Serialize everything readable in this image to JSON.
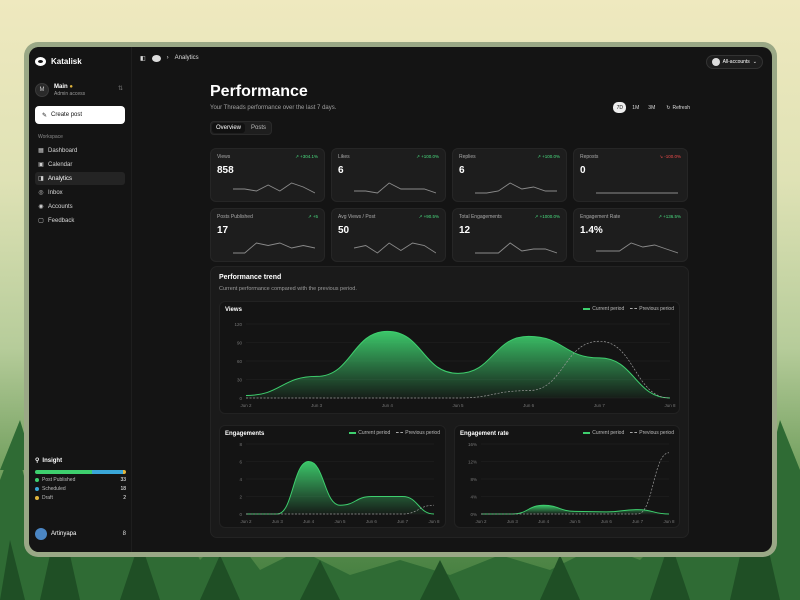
{
  "app": {
    "name": "Katalisk"
  },
  "account": {
    "initial": "M",
    "name": "Main",
    "role": "Admin access"
  },
  "create_post": "Create post",
  "sidebar": {
    "section": "Workspace",
    "items": [
      {
        "label": "Dashboard"
      },
      {
        "label": "Calendar"
      },
      {
        "label": "Analytics"
      },
      {
        "label": "Inbox"
      },
      {
        "label": "Accounts"
      },
      {
        "label": "Feedback"
      }
    ]
  },
  "insight": {
    "title": "Insight",
    "items": [
      {
        "label": "Post Published",
        "value": "33",
        "color": "#3ecf6e"
      },
      {
        "label": "Scheduled",
        "value": "18",
        "color": "#3aa7d8"
      },
      {
        "label": "Draft",
        "value": "2",
        "color": "#e0b43c"
      }
    ]
  },
  "user": {
    "name": "Artinyapa",
    "count": "8"
  },
  "breadcrumb": {
    "page": "Analytics"
  },
  "account_switch": "All-accounts",
  "page": {
    "title": "Performance",
    "subtitle": "Your Threads performance over the last 7 days."
  },
  "ranges": [
    "7D",
    "1M",
    "3M"
  ],
  "refresh": "Refresh",
  "tabs": [
    "Overview",
    "Posts"
  ],
  "metrics": [
    {
      "label": "Views",
      "change": "+304.1%",
      "value": "858",
      "trend": "up",
      "spark": [
        3,
        3,
        2,
        5,
        2,
        6,
        4,
        1
      ]
    },
    {
      "label": "Likes",
      "change": "+100.0%",
      "value": "6",
      "trend": "up",
      "spark": [
        2,
        2,
        1,
        6,
        3,
        3,
        3,
        1
      ]
    },
    {
      "label": "Replies",
      "change": "+100.0%",
      "value": "6",
      "trend": "up",
      "spark": [
        1,
        1,
        2,
        6,
        3,
        4,
        2,
        2
      ]
    },
    {
      "label": "Reposts",
      "change": "-100.0%",
      "value": "0",
      "trend": "down",
      "spark": [
        2,
        2,
        2,
        2,
        2,
        2,
        2,
        2
      ]
    },
    {
      "label": "Posts Published",
      "change": "+5",
      "value": "17",
      "trend": "up",
      "spark": [
        1,
        1,
        5,
        4,
        5,
        3,
        4,
        3
      ]
    },
    {
      "label": "Avg Views / Post",
      "change": "+90.5%",
      "value": "50",
      "trend": "up",
      "spark": [
        3,
        4,
        1,
        5,
        2,
        5,
        4,
        1
      ]
    },
    {
      "label": "Total Engagements",
      "change": "+1000.0%",
      "value": "12",
      "trend": "up",
      "spark": [
        1,
        1,
        1,
        6,
        2,
        3,
        3,
        1
      ]
    },
    {
      "label": "Engagement Rate",
      "change": "+136.5%",
      "value": "1.4%",
      "trend": "up",
      "spark": [
        2,
        2,
        2,
        6,
        4,
        5,
        3,
        1
      ]
    }
  ],
  "trend": {
    "title": "Performance trend",
    "subtitle": "Current performance compared with the previous period."
  },
  "legend": {
    "current": "Current period",
    "previous": "Previous period"
  },
  "chart_data": [
    {
      "type": "area",
      "title": "Views",
      "categories": [
        "Jun 2",
        "Jun 3",
        "Jun 4",
        "Jun 5",
        "Jun 6",
        "Jun 7",
        "Jun 8"
      ],
      "ylim": [
        0,
        120
      ],
      "yticks": [
        "0",
        "30",
        "60",
        "90",
        "120"
      ],
      "series": [
        {
          "name": "Current period",
          "values": [
            4,
            35,
            108,
            40,
            100,
            65,
            0
          ]
        },
        {
          "name": "Previous period",
          "values": [
            0,
            0,
            0,
            0,
            12,
            92,
            0
          ]
        }
      ]
    },
    {
      "type": "area",
      "title": "Engagements",
      "categories": [
        "Jun 2",
        "Jun 3",
        "Jun 4",
        "Jun 5",
        "Jun 6",
        "Jun 7",
        "Jun 8"
      ],
      "ylim": [
        0,
        8
      ],
      "yticks": [
        "0",
        "2",
        "4",
        "6",
        "8"
      ],
      "series": [
        {
          "name": "Current period",
          "values": [
            0,
            0,
            6,
            1,
            2,
            2,
            0
          ]
        },
        {
          "name": "Previous period",
          "values": [
            0,
            0,
            0,
            0,
            0,
            0,
            1
          ]
        }
      ]
    },
    {
      "type": "area",
      "title": "Engagement rate",
      "categories": [
        "Jun 2",
        "Jun 3",
        "Jun 4",
        "Jun 5",
        "Jun 6",
        "Jun 7",
        "Jun 8"
      ],
      "ylim": [
        0,
        16
      ],
      "yticks": [
        "0%",
        "4%",
        "8%",
        "12%",
        "16%"
      ],
      "series": [
        {
          "name": "Current period",
          "values": [
            0,
            0,
            2,
            0.6,
            0.5,
            1,
            0
          ]
        },
        {
          "name": "Previous period",
          "values": [
            0,
            0,
            0,
            0,
            0,
            0,
            14
          ]
        }
      ]
    }
  ]
}
